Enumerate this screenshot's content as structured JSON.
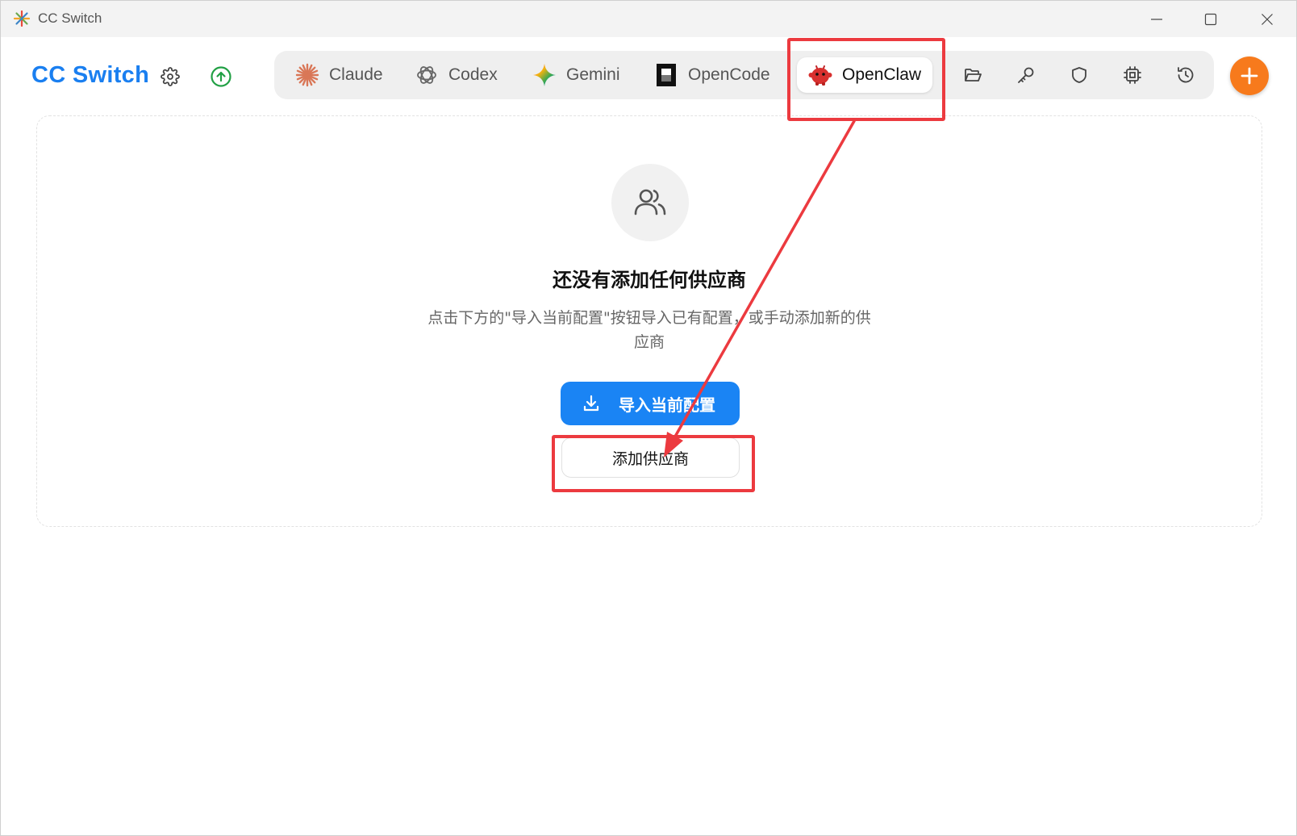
{
  "window": {
    "title": "CC Switch"
  },
  "header": {
    "brand": "CC Switch",
    "settings_icon": "gear-icon",
    "update_icon": "arrow-up-circle-icon",
    "update_color": "#22a045"
  },
  "tabs": [
    {
      "label": "Claude",
      "icon": "claude-starburst-icon",
      "color": "#d97757"
    },
    {
      "label": "Codex",
      "icon": "openai-knot-icon",
      "color": "#666666"
    },
    {
      "label": "Gemini",
      "icon": "gemini-sparkle-icon",
      "color": "#4a7bf7"
    },
    {
      "label": "OpenCode",
      "icon": "opencode-square-icon",
      "color": "#111111"
    },
    {
      "label": "OpenClaw",
      "icon": "openclaw-mascot-icon",
      "color": "#d8302f",
      "active": true
    }
  ],
  "tools": [
    "folder-open-icon",
    "key-icon",
    "shield-icon",
    "chip-icon",
    "history-icon"
  ],
  "add_button": {
    "icon": "plus-icon",
    "color": "#f77a1c"
  },
  "empty_state": {
    "icon": "users-icon",
    "title": "还没有添加任何供应商",
    "description": "点击下方的\"导入当前配置\"按钮导入已有配置，或手动添加新的供应商",
    "import_label": "导入当前配置",
    "import_icon": "download-icon",
    "add_label": "添加供应商"
  },
  "annotation": {
    "color": "#ec3a3f"
  }
}
